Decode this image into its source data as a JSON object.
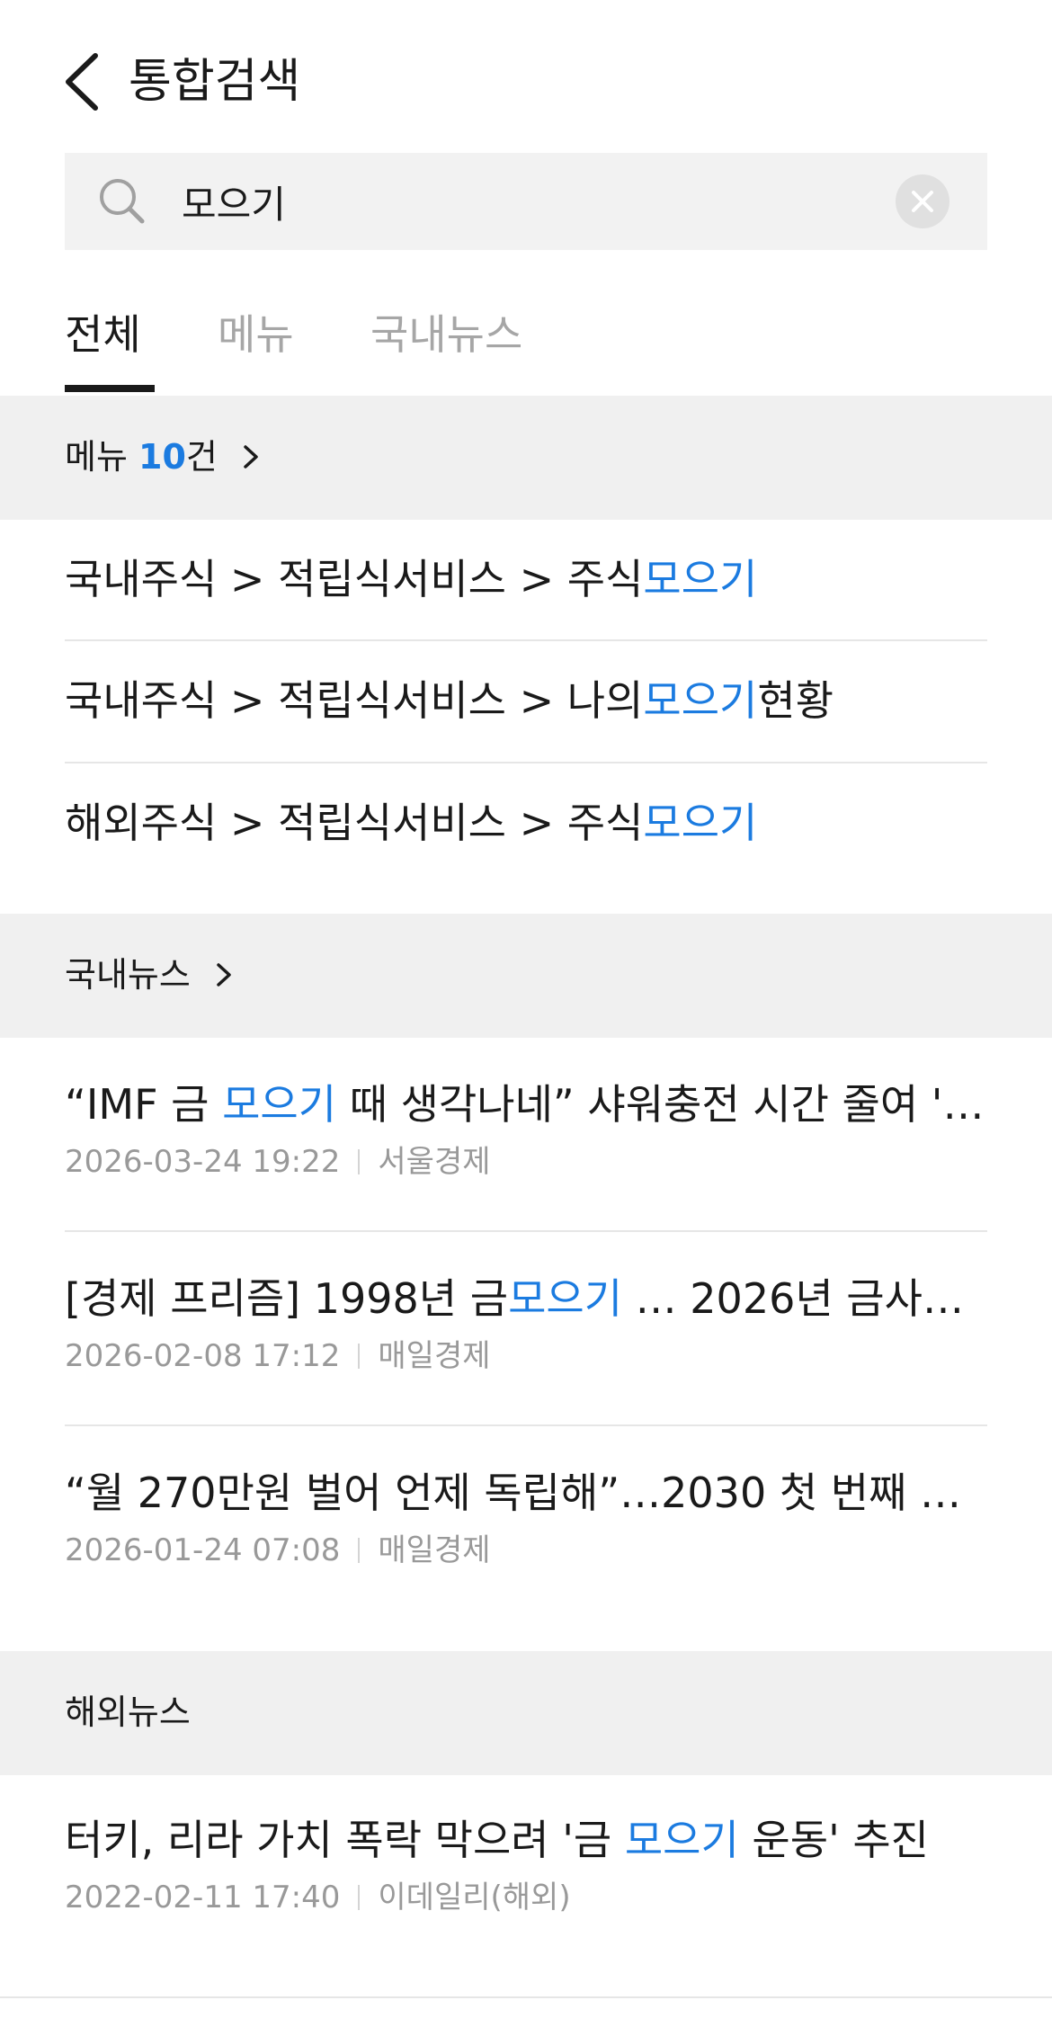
{
  "header": {
    "title": "통합검색"
  },
  "search": {
    "value": "모으기"
  },
  "tabs": [
    {
      "label": "전체",
      "active": true
    },
    {
      "label": "메뉴",
      "active": false
    },
    {
      "label": "국내뉴스",
      "active": false
    }
  ],
  "menu_section": {
    "label": "메뉴",
    "count": "10",
    "unit": "건",
    "items": [
      {
        "prefix": "국내주식 > 적립식서비스 > 주식",
        "highlight": "모으기",
        "suffix": ""
      },
      {
        "prefix": "국내주식 > 적립식서비스 > 나의",
        "highlight": "모으기",
        "suffix": "현황"
      },
      {
        "prefix": "해외주식 > 적립식서비스 > 주식",
        "highlight": "모으기",
        "suffix": ""
      }
    ]
  },
  "domestic_news": {
    "label": "국내뉴스",
    "items": [
      {
        "prefix": "“IMF 금 ",
        "highlight": "모으기",
        "suffix": " 때 생각나네” 샤워충전 시간 줄여 '…",
        "date": "2026-03-24 19:22",
        "source": "서울경제"
      },
      {
        "prefix": "[경제 프리즘] 1998년 금",
        "highlight": "모으기",
        "suffix": " … 2026년 금사…",
        "date": "2026-02-08 17:12",
        "source": "매일경제"
      },
      {
        "prefix": "“월 270만원 벌어 언제 독립해”…2030 첫 번째 …",
        "highlight": "",
        "suffix": "",
        "date": "2026-01-24 07:08",
        "source": "매일경제"
      }
    ]
  },
  "overseas_news": {
    "label": "해외뉴스",
    "items": [
      {
        "prefix": "터키, 리라 가치 폭락 막으려 '금 ",
        "highlight": "모으기",
        "suffix": " 운동' 추진",
        "date": "2022-02-11 17:40",
        "source": "이데일리(해외)"
      }
    ]
  },
  "colors": {
    "accent": "#1b7be0",
    "section_bg": "#f0f0f0",
    "muted": "#999999"
  },
  "icons": {
    "back": "chevron-left-icon",
    "search": "search-icon",
    "clear": "close-icon",
    "more": "chevron-right-icon"
  }
}
